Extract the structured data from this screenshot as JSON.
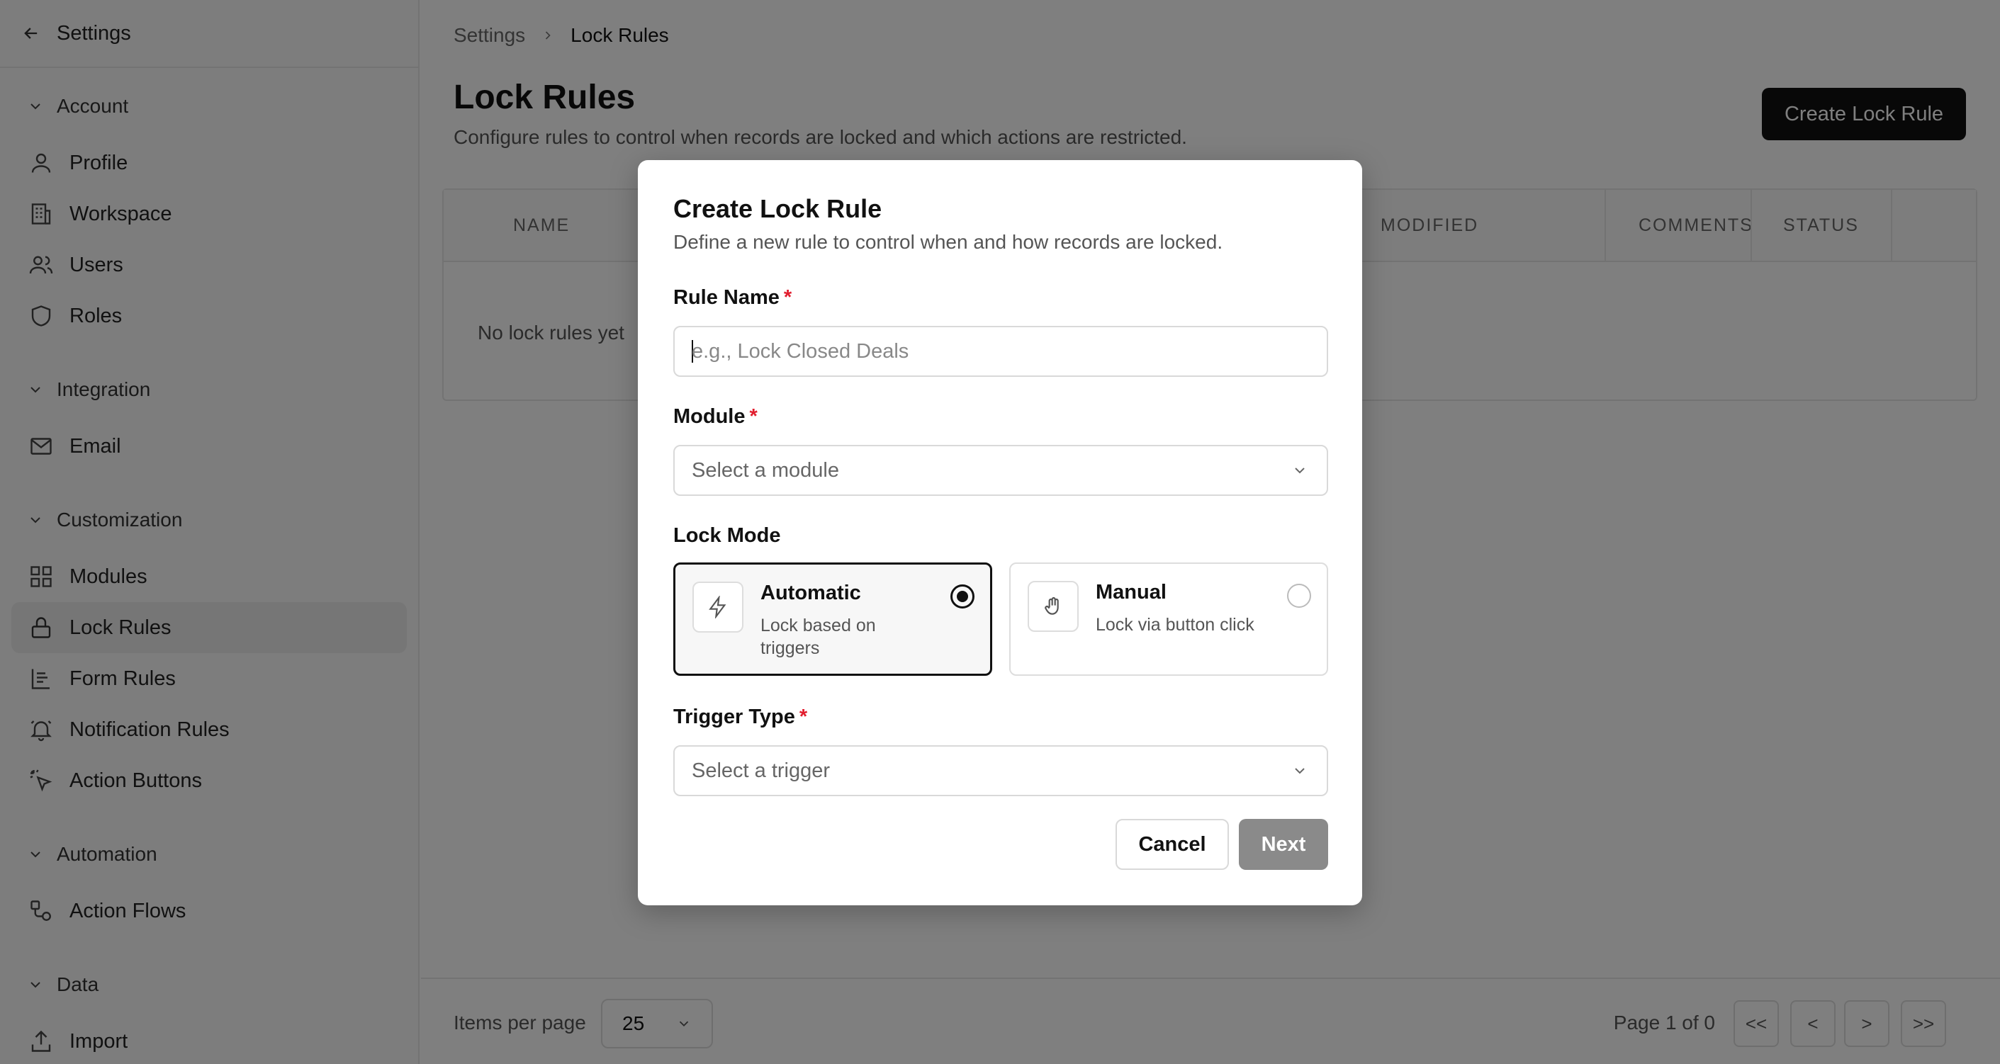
{
  "sidebar": {
    "back_label": "Settings",
    "groups": {
      "account": "Account",
      "integration": "Integration",
      "customization": "Customization",
      "automation": "Automation",
      "data": "Data"
    },
    "items": {
      "profile": "Profile",
      "workspace": "Workspace",
      "users": "Users",
      "roles": "Roles",
      "email": "Email",
      "modules": "Modules",
      "lock_rules": "Lock Rules",
      "form_rules": "Form Rules",
      "notification_rules": "Notification Rules",
      "action_buttons": "Action Buttons",
      "action_flows": "Action Flows",
      "import": "Import"
    },
    "active_item": "lock_rules"
  },
  "breadcrumb": {
    "root": "Settings",
    "current": "Lock Rules"
  },
  "page": {
    "title": "Lock Rules",
    "subtitle": "Configure rules to control when records are locked and which actions are restricted.",
    "create_button": "Create Lock Rule"
  },
  "table": {
    "columns": {
      "name": "NAME",
      "modified": "MODIFIED",
      "comments": "COMMENTS",
      "status": "STATUS"
    },
    "empty_text": "No lock rules yet"
  },
  "footer": {
    "items_per_page_label": "Items per page",
    "items_per_page_value": "25",
    "page_info": "Page 1 of 0",
    "first": "<<",
    "prev": "<",
    "next": ">",
    "last": ">>"
  },
  "modal": {
    "title": "Create Lock Rule",
    "subtitle": "Define a new rule to control when and how records are locked.",
    "rule_name_label": "Rule Name",
    "rule_name_placeholder": "e.g., Lock Closed Deals",
    "module_label": "Module",
    "module_placeholder": "Select a module",
    "lock_mode_label": "Lock Mode",
    "modes": {
      "automatic": {
        "title": "Automatic",
        "desc": "Lock based on triggers",
        "selected": true
      },
      "manual": {
        "title": "Manual",
        "desc": "Lock via button click",
        "selected": false
      }
    },
    "trigger_label": "Trigger Type",
    "trigger_placeholder": "Select a trigger",
    "required_mark": "*",
    "cancel": "Cancel",
    "next": "Next"
  },
  "colors": {
    "primary": "#111111",
    "required": "#e11d2e",
    "disabled_button": "#8a8a8a",
    "overlay": "rgba(0,0,0,0.5)"
  }
}
